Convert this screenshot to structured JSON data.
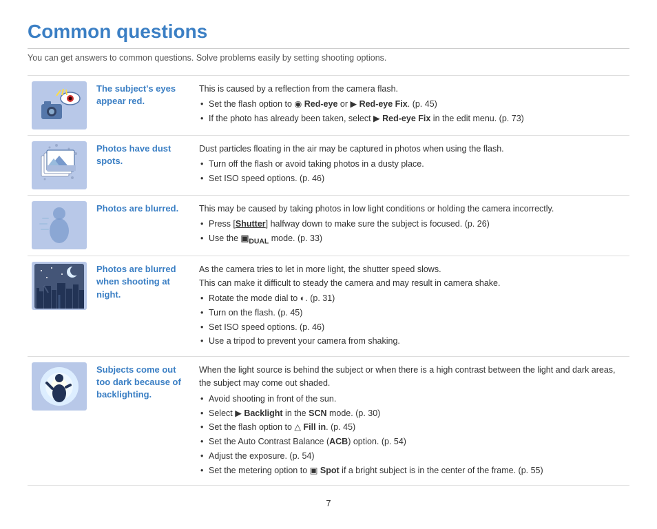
{
  "page": {
    "title": "Common questions",
    "subtitle": "You can get answers to common questions. Solve problems easily by setting shooting options.",
    "page_number": "7"
  },
  "rows": [
    {
      "id": "red-eye",
      "label": "The subject's eyes appear red.",
      "desc_intro": "This is caused by a reflection from the camera flash.",
      "bullets": [
        "Set the flash option to  Red-eye or  Red-eye Fix. (p. 45)",
        "If the photo has already been taken, select  Red-eye Fix in the edit menu. (p. 73)"
      ]
    },
    {
      "id": "dust",
      "label": "Photos have dust spots.",
      "desc_intro": "Dust particles floating in the air may be captured in photos when using the flash.",
      "bullets": [
        "Turn off the flash or avoid taking photos in a dusty place.",
        "Set ISO speed options. (p. 46)"
      ]
    },
    {
      "id": "blurred",
      "label": "Photos are blurred.",
      "desc_intro": "This may be caused by taking photos in low light conditions or holding the camera incorrectly.",
      "bullets": [
        "Press [Shutter] halfway down to make sure the subject is focused. (p. 26)",
        "Use the  mode. (p. 33)"
      ]
    },
    {
      "id": "night",
      "label": "Photos are blurred when shooting at night.",
      "desc_intro": "As the camera tries to let in more light, the shutter speed slows.\nThis can make it difficult to steady the camera and may result in camera shake.",
      "bullets": [
        "Rotate the mode dial to . (p. 31)",
        "Turn on the flash. (p. 45)",
        "Set ISO speed options. (p. 46)",
        "Use a tripod to prevent your camera from shaking."
      ]
    },
    {
      "id": "backlight",
      "label": "Subjects come out too dark because of backlighting.",
      "desc_intro": "When the light source is behind the subject or when there is a high contrast between\nthe light and dark areas, the subject may come out shaded.",
      "bullets": [
        "Avoid shooting in front of the sun.",
        "Select  Backlight in the SCN mode. (p. 30)",
        "Set the flash option to  Fill in. (p. 45)",
        "Set the Auto Contrast Balance (ACB) option. (p. 54)",
        "Adjust the exposure. (p. 54)",
        "Set the metering option to  Spot if a bright subject is in the center of the frame. (p. 55)"
      ]
    }
  ]
}
